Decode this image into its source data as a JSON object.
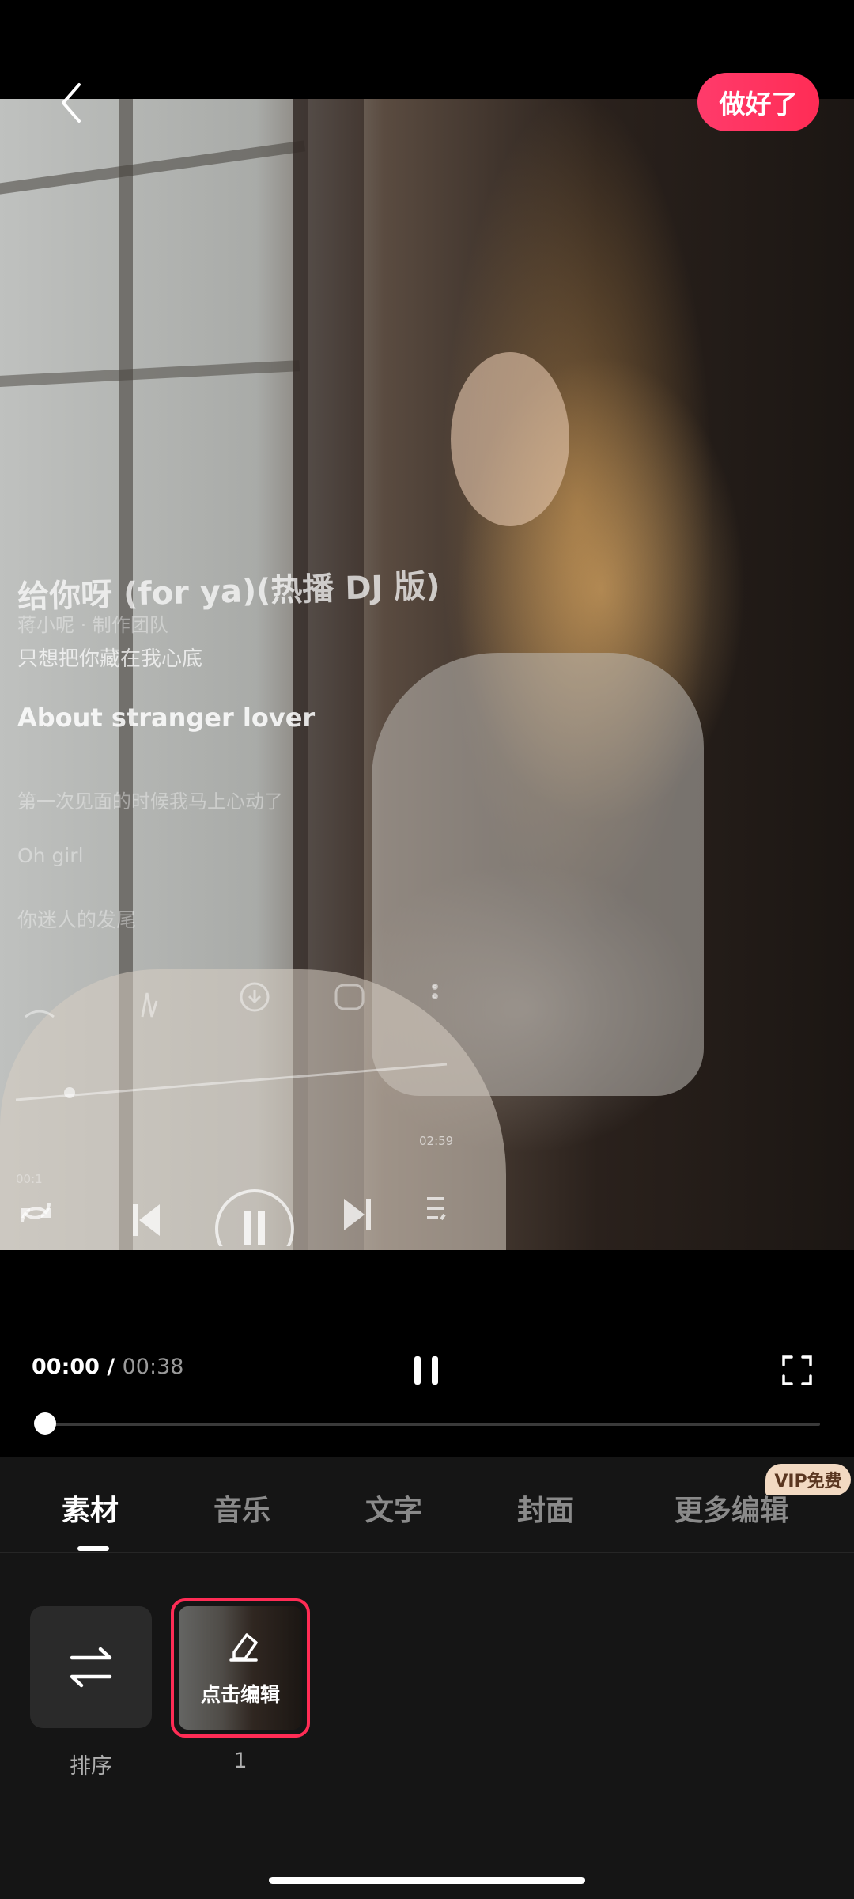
{
  "header": {
    "back_icon": "chevron-left-icon",
    "done_label": "做好了",
    "done_color": "#ff2c55"
  },
  "preview": {
    "lyrics": [
      "给你呀 (for ya)(热播 DJ 版)",
      "蒋小呢 · 制作团队",
      "只想把你藏在我心底",
      "About stranger lover",
      "第一次见面的时候我马上心动了",
      "Oh girl",
      "你迷人的发尾"
    ],
    "embedded_player": {
      "time_end": "02:59",
      "time_start": "00:1"
    }
  },
  "playback": {
    "current_time": "00:00",
    "separator": " / ",
    "total_time": "00:38",
    "progress": 0.0,
    "pause_icon": "pause-icon",
    "fullscreen_icon": "fullscreen-icon"
  },
  "tabs": {
    "items": [
      {
        "label": "素材",
        "active": true
      },
      {
        "label": "音乐",
        "active": false
      },
      {
        "label": "文字",
        "active": false
      },
      {
        "label": "封面",
        "active": false
      },
      {
        "label": "更多编辑",
        "active": false
      }
    ],
    "vip_badge": "VIP免费"
  },
  "materials": {
    "sort_label": "排序",
    "sort_icon": "swap-arrows-icon",
    "clip_edit_label": "点击编辑",
    "clip_edit_icon": "eraser-edit-icon",
    "clip_index": "1"
  }
}
